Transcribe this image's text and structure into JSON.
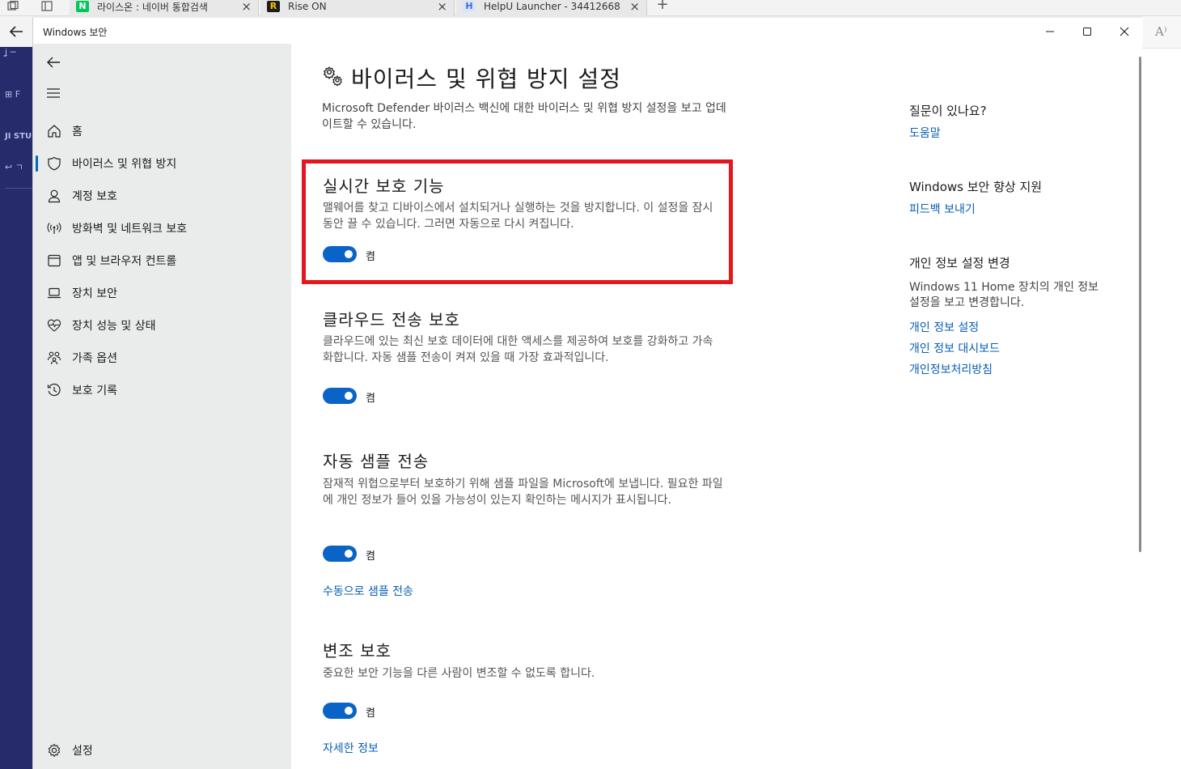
{
  "browser": {
    "tabs": [
      {
        "title": "라이스온 : 네이버 통합검색",
        "favicon": "N",
        "favicon_color": "#03c75a"
      },
      {
        "title": "Rise ON",
        "favicon": "R",
        "favicon_color": "#1d1d1d"
      },
      {
        "title": "HelpU Launcher - 34412668",
        "favicon": "H",
        "favicon_color": "#3b6fd6"
      }
    ],
    "new_tab_label": "+",
    "close_tab_glyph": "×",
    "read_aloud_label": "A⁾",
    "left_fragments": [
      "ʝ ─",
      "⊞ F",
      "JI STU",
      "↩ ㄱ"
    ]
  },
  "window": {
    "title": "Windows 보안",
    "controls": {
      "minimize": "—",
      "maximize": "☐",
      "close": "✕"
    }
  },
  "sidebar": {
    "items": [
      {
        "label": "홈",
        "icon": "home-icon"
      },
      {
        "label": "바이러스 및 위협 방지",
        "icon": "shield-icon",
        "selected": true
      },
      {
        "label": "계정 보호",
        "icon": "person-icon"
      },
      {
        "label": "방화벽 및 네트워크 보호",
        "icon": "antenna-icon"
      },
      {
        "label": "앱 및 브라우저 컨트롤",
        "icon": "app-window-icon"
      },
      {
        "label": "장치 보안",
        "icon": "laptop-icon"
      },
      {
        "label": "장치 성능 및 상태",
        "icon": "heart-pulse-icon"
      },
      {
        "label": "가족 옵션",
        "icon": "family-icon"
      },
      {
        "label": "보호 기록",
        "icon": "history-icon"
      }
    ],
    "settings_label": "설정"
  },
  "main": {
    "title": "바이러스 및 위협 방지 설정",
    "description": "Microsoft Defender 바이러스 백신에 대한 바이러스 및 위협 방지 설정을 보고 업데이트할 수 있습니다.",
    "sections": [
      {
        "title": "실시간 보호 기능",
        "description": "맬웨어를 찾고 디바이스에서 설치되거나 실행하는 것을 방지합니다. 이 설정을 잠시 동안 끌 수 있습니다. 그러면 자동으로 다시 켜집니다.",
        "toggle_on": true,
        "toggle_label": "켬"
      },
      {
        "title": "클라우드 전송 보호",
        "description": "클라우드에 있는 최신 보호 데이터에 대한 액세스를 제공하여 보호를 강화하고 가속화합니다. 자동 샘플 전송이 켜져 있을 때 가장 효과적입니다.",
        "toggle_on": true,
        "toggle_label": "켬"
      },
      {
        "title": "자동 샘플 전송",
        "description": "잠재적 위협으로부터 보호하기 위해 샘플 파일을 Microsoft에 보냅니다. 필요한 파일에 개인 정보가 들어 있을 가능성이 있는지 확인하는 메시지가 표시됩니다.",
        "toggle_on": true,
        "toggle_label": "켬",
        "link": "수동으로 샘플 전송"
      },
      {
        "title": "변조 보호",
        "description": "중요한 보안 기능을 다른 사람이 변조할 수 없도록 합니다.",
        "toggle_on": true,
        "toggle_label": "켬",
        "link": "자세한 정보"
      }
    ]
  },
  "aside": {
    "question_heading": "질문이 있나요?",
    "help_link": "도움말",
    "improve_heading": "Windows 보안 향상 지원",
    "feedback_link": "피드백 보내기",
    "privacy_heading": "개인 정보 설정 변경",
    "privacy_text": "Windows 11 Home 장치의 개인 정보 설정을 보고 변경합니다.",
    "privacy_links": [
      "개인 정보 설정",
      "개인 정보 대시보드",
      "개인정보처리방침"
    ]
  },
  "colors": {
    "accent": "#0a63c7",
    "highlight": "#e5161e",
    "link": "#0a5fb4"
  }
}
